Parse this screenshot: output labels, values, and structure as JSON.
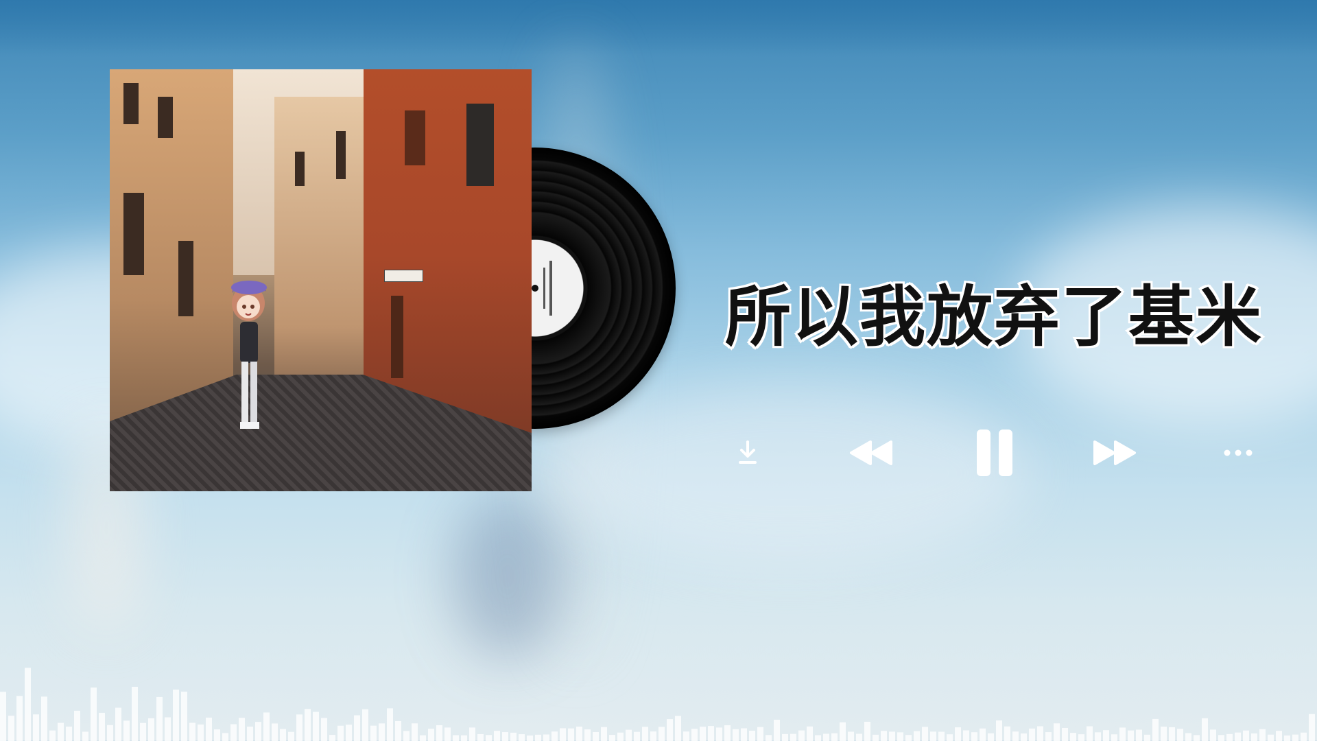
{
  "song": {
    "title": "所以我放弃了基米"
  },
  "controls": {
    "download_icon": "download-icon",
    "previous_icon": "rewind-icon",
    "play_state_icon": "pause-icon",
    "next_icon": "fast-forward-icon",
    "more_icon": "more-icon"
  },
  "colors": {
    "title_text": "#111111",
    "title_outline": "#ffffff",
    "control_icons": "#ffffff"
  }
}
